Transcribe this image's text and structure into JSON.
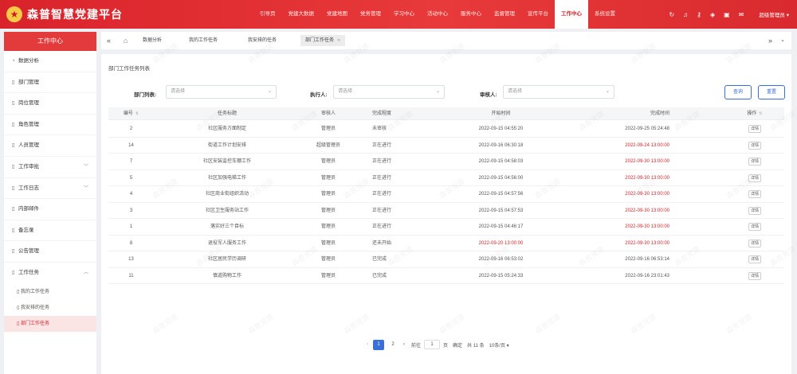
{
  "app": {
    "title": "森普智慧党建平台",
    "logo_glyph": "★"
  },
  "topnav": {
    "items": [
      "引导页",
      "党建大数据",
      "党建地图",
      "党务管理",
      "学习中心",
      "活动中心",
      "服务中心",
      "监督管理",
      "宣传平台",
      "工作中心",
      "系统设置"
    ],
    "active_index": 9,
    "icons": [
      "refresh-icon",
      "bell-icon",
      "lock-icon",
      "tag-icon",
      "fullscreen-icon",
      "chat-icon"
    ],
    "user": "超级管理员 ▾"
  },
  "sidebar": {
    "header": "工作中心",
    "items": [
      {
        "label": "数据分析",
        "icon": "chart-icon",
        "expandable": false
      },
      {
        "label": "部门管理",
        "icon": "doc-icon",
        "expandable": false
      },
      {
        "label": "岗位管理",
        "icon": "doc-icon",
        "expandable": false
      },
      {
        "label": "角色管理",
        "icon": "doc-icon",
        "expandable": false
      },
      {
        "label": "人员管理",
        "icon": "doc-icon",
        "expandable": false
      },
      {
        "label": "工作审批",
        "icon": "doc-icon",
        "expandable": true
      },
      {
        "label": "工作日志",
        "icon": "doc-icon",
        "expandable": true
      },
      {
        "label": "内部邮件",
        "icon": "doc-icon",
        "expandable": false
      },
      {
        "label": "备忘录",
        "icon": "doc-icon",
        "expandable": false
      },
      {
        "label": "公告管理",
        "icon": "doc-icon",
        "expandable": false
      },
      {
        "label": "工作任务",
        "icon": "doc-icon",
        "expandable": true,
        "expanded": true
      }
    ],
    "subitems": [
      {
        "label": "我的工作任务",
        "active": false
      },
      {
        "label": "我安排的任务",
        "active": false
      },
      {
        "label": "部门工作任务",
        "active": true
      }
    ]
  },
  "tabs": {
    "items": [
      "数据分析",
      "我的工作任务",
      "我安排的任务",
      "部门工作任务"
    ],
    "active_index": 3
  },
  "main": {
    "panel_title": "部门工作任务列表",
    "filters": [
      {
        "label": "部门列表:",
        "placeholder": "请选择"
      },
      {
        "label": "执行人:",
        "placeholder": "请选择"
      },
      {
        "label": "审核人:",
        "placeholder": "请选择"
      }
    ],
    "search_button": "查询",
    "reset_button": "重置"
  },
  "table": {
    "columns": [
      "编号",
      "任务标题",
      "审核人",
      "完成程度",
      "开始时间",
      "完成时间",
      "操作"
    ],
    "rows": [
      {
        "id": "2",
        "title": "社区服务方面制定",
        "reviewer": "管理员",
        "status": "未审核",
        "start": "2022-09-15 04:55:20",
        "end": "2022-09-25 05:24:48",
        "end_overdue": false,
        "action": "详情"
      },
      {
        "id": "14",
        "title": "街道工作计划安排",
        "reviewer": "超级管理员",
        "status": "正在进行",
        "start": "2022-09-16 06:30:18",
        "end": "2022-09-24 13:00:00",
        "end_overdue": true,
        "action": "详情"
      },
      {
        "id": "7",
        "title": "社区安装监控车棚工作",
        "reviewer": "管理员",
        "status": "正在进行",
        "start": "2022-09-15 04:58:03",
        "end": "2022-09-30 13:00:00",
        "end_overdue": true,
        "action": "详情"
      },
      {
        "id": "5",
        "title": "社区加强电梯工作",
        "reviewer": "管理员",
        "status": "正在进行",
        "start": "2022-09-15 04:56:00",
        "end": "2022-09-30 13:00:00",
        "end_overdue": true,
        "action": "详情"
      },
      {
        "id": "4",
        "title": "社区商业街组织活动",
        "reviewer": "管理员",
        "status": "正在进行",
        "start": "2022-09-15 04:57:56",
        "end": "2022-09-30 13:00:00",
        "end_overdue": true,
        "action": "详情"
      },
      {
        "id": "3",
        "title": "社区卫生服务站工作",
        "reviewer": "管理员",
        "status": "正在进行",
        "start": "2022-09-15 04:57:53",
        "end": "2022-09-30 13:00:00",
        "end_overdue": true,
        "action": "详情"
      },
      {
        "id": "1",
        "title": "落实好三个目标",
        "reviewer": "管理员",
        "status": "正在进行",
        "start": "2022-09-15 04:46:17",
        "end": "2022-09-30 13:00:00",
        "end_overdue": true,
        "action": "详情"
      },
      {
        "id": "8",
        "title": "退役军人服务工作",
        "reviewer": "管理员",
        "status": "还未开始",
        "start": "2022-09-20 13:00:00",
        "start_red": true,
        "end": "2022-09-30 13:00:00",
        "end_overdue": true,
        "action": "详情"
      },
      {
        "id": "13",
        "title": "社区居民学历调研",
        "reviewer": "管理员",
        "status": "已完成",
        "start": "2022-09-16 06:53:02",
        "end": "2022-09-16 06:53:14",
        "end_overdue": false,
        "action": "详情"
      },
      {
        "id": "11",
        "title": "慎道购物工作",
        "reviewer": "管理员",
        "status": "已完成",
        "start": "2022-09-15 05:24:33",
        "end": "2022-09-16 23:01:43",
        "end_overdue": false,
        "action": "详情"
      }
    ]
  },
  "pagination": {
    "pages": [
      "1",
      "2"
    ],
    "current": "1",
    "goto_label": "前往",
    "goto_value": "1",
    "page_suffix": "页",
    "confirm_label": "确定",
    "total_label": "共 11 条",
    "page_size_label": "10条/页 ▾"
  },
  "watermark_text": "森普党建"
}
